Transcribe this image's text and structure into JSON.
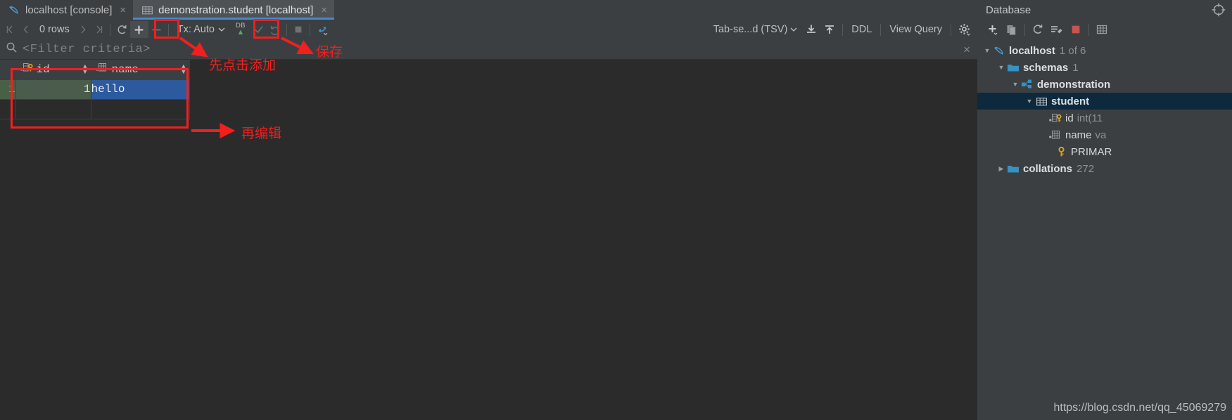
{
  "tabs": [
    {
      "label": "localhost [console]",
      "icon": "dolphin-icon",
      "active": false,
      "close": "×"
    },
    {
      "label": "demonstration.student [localhost]",
      "icon": "table-icon",
      "active": true,
      "close": "×"
    }
  ],
  "toolbar": {
    "nav_first": "|‹",
    "nav_prev": "‹",
    "rows_label": "0 rows",
    "nav_next": "›",
    "nav_last": "›|",
    "refresh": "refresh-icon",
    "add_row": "+",
    "remove_row": "−",
    "tx_label": "Tx: Auto",
    "tx_caret": "⌄",
    "submit_db": "DB",
    "submit_arrow": "⬆",
    "commit": "✓",
    "rollback": "↺",
    "stop": "■",
    "transpose": "transpose-icon",
    "format_label": "Tab-se...d (TSV)",
    "format_caret": "⌄",
    "import": "download-icon",
    "export": "upload-icon",
    "ddl_label": "DDL",
    "view_query_label": "View Query",
    "settings": "gear-icon"
  },
  "db_toolbar": {
    "add": "+",
    "copy": "copy-icon",
    "refresh": "refresh-icon",
    "tools": "wrench-icon",
    "disconnect": "stop-icon",
    "grid": "grid-icon"
  },
  "db_panel": {
    "title": "Database",
    "locate_icon": "crosshair-icon"
  },
  "filter": {
    "icon": "search-icon",
    "placeholder": "<Filter criteria>",
    "close": "×"
  },
  "grid": {
    "columns": [
      {
        "label": "id",
        "icon": "key-column-icon",
        "sortable": true
      },
      {
        "label": "name",
        "icon": "text-column-icon",
        "sortable": true
      }
    ],
    "rows": [
      {
        "num": "1",
        "id": "1",
        "name": "hello"
      }
    ]
  },
  "tree": [
    {
      "indent": 0,
      "toggle": "▼",
      "icon": "dolphin-icon",
      "label": "localhost",
      "sub": "1 of 6",
      "bold": true,
      "selected": false
    },
    {
      "indent": 1,
      "toggle": "▼",
      "icon": "folder-icon",
      "label": "schemas",
      "sub": "1",
      "bold": true,
      "selected": false
    },
    {
      "indent": 2,
      "toggle": "▼",
      "icon": "schema-icon",
      "label": "demonstration",
      "sub": "",
      "bold": true,
      "selected": false
    },
    {
      "indent": 3,
      "toggle": "▼",
      "icon": "table-icon",
      "label": "student",
      "sub": "",
      "bold": true,
      "selected": true
    },
    {
      "indent": 4,
      "toggle": "",
      "icon": "key-column-icon",
      "label": "id",
      "type": "int(11",
      "bold": false,
      "selected": false
    },
    {
      "indent": 4,
      "toggle": "",
      "icon": "text-column-icon",
      "label": "name",
      "type": "va",
      "bold": false,
      "selected": false
    },
    {
      "indent": 4,
      "toggle": "",
      "icon": "key-icon",
      "label": "PRIMAR",
      "type": "",
      "bold": false,
      "selected": false
    },
    {
      "indent": 1,
      "toggle": "▶",
      "icon": "folder-icon",
      "label": "collations",
      "sub": "272",
      "bold": true,
      "selected": false
    }
  ],
  "annotations": {
    "accent_color": "#f21f1f",
    "add_note": "先点击添加",
    "save_note": "保存",
    "edit_note": "再编辑"
  },
  "watermark": "https://blog.csdn.net/qq_45069279"
}
